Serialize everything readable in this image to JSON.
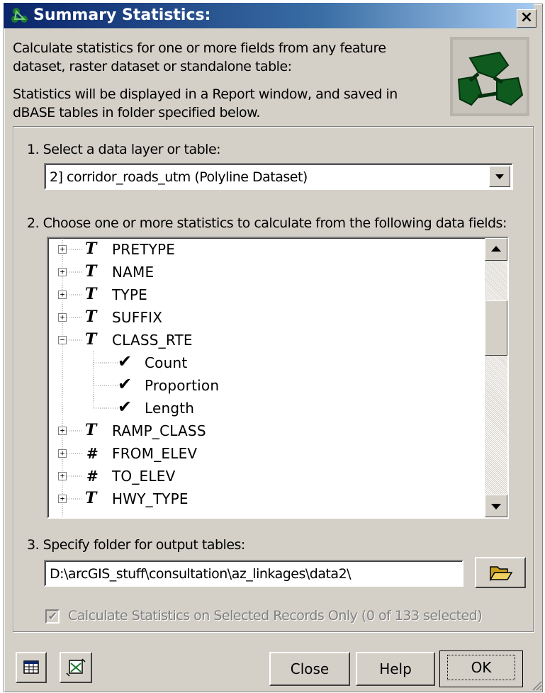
{
  "window": {
    "title": "Summary Statistics:",
    "close_glyph": "×"
  },
  "description": {
    "line1": "Calculate statistics for one or more fields from any feature",
    "line2": "dataset, raster dataset or standalone table:",
    "line3": "Statistics will be displayed in a Report window, and saved in",
    "line4": "dBASE tables in folder specified below."
  },
  "step1": {
    "label": "1.  Select a data layer or table:",
    "selected": "2] corridor_roads_utm  (Polyline Dataset)"
  },
  "step2": {
    "label": "2.  Choose one or more statistics to calculate from the following data fields:",
    "fields": [
      {
        "type_icon": "T",
        "name": "PRETYPE",
        "expander": "+"
      },
      {
        "type_icon": "T",
        "name": "NAME",
        "expander": "+"
      },
      {
        "type_icon": "T",
        "name": "TYPE",
        "expander": "+"
      },
      {
        "type_icon": "T",
        "name": "SUFFIX",
        "expander": "+"
      },
      {
        "type_icon": "T",
        "name": "CLASS_RTE",
        "expander": "−"
      },
      {
        "stat": "Count",
        "check": "✔"
      },
      {
        "stat": "Proportion",
        "check": "✔"
      },
      {
        "stat": "Length",
        "check": "✔"
      },
      {
        "type_icon": "T",
        "name": "RAMP_CLASS",
        "expander": "+"
      },
      {
        "type_icon": "#",
        "name": "FROM_ELEV",
        "expander": "+"
      },
      {
        "type_icon": "#",
        "name": "TO_ELEV",
        "expander": "+"
      },
      {
        "type_icon": "T",
        "name": "HWY_TYPE",
        "expander": "+"
      }
    ]
  },
  "step3": {
    "label": "3.  Specify folder for output tables:",
    "path": "D:\\arcGIS_stuff\\consultation\\az_linkages\\data2\\"
  },
  "selected_only": {
    "label": "Calculate Statistics on Selected Records Only (0 of 133 selected)",
    "checked": true
  },
  "buttons": {
    "close": "Close",
    "help": "Help",
    "ok": "OK"
  },
  "colors": {
    "titlebar_start": "#0a246a",
    "titlebar_end": "#a6caf0",
    "dialog_face": "#d4d0c8",
    "logo_green": "#0f5a1e"
  }
}
